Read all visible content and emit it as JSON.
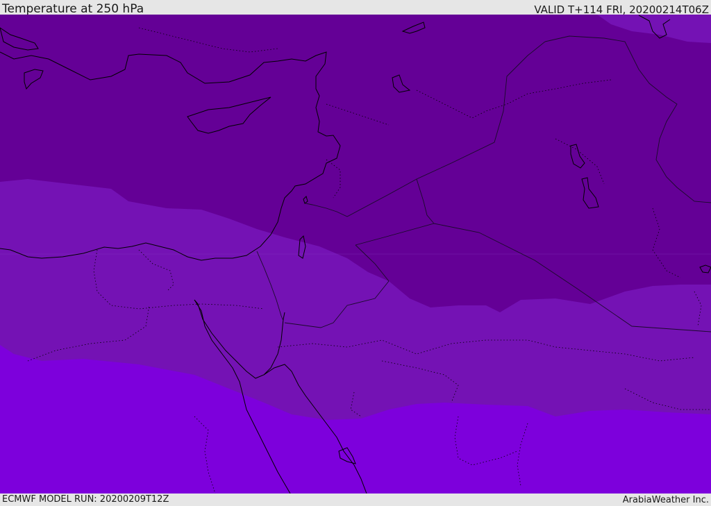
{
  "header": {
    "title": "Temperature at 250 hPa",
    "valid_time": "VALID T+114 FRI, 20200214T06Z"
  },
  "footer": {
    "model_run": "ECMWF MODEL RUN: 20200209T12Z",
    "credit": "ArabiaWeather Inc."
  },
  "colors": {
    "band_cold": "#640096",
    "band_mid": "#7412b4",
    "band_warm": "#7d00dc",
    "coast": "#000000",
    "border": "#1a0a2a"
  },
  "map": {
    "region": "Eastern Mediterranean / Middle East",
    "field": "250 hPa temperature bands"
  }
}
